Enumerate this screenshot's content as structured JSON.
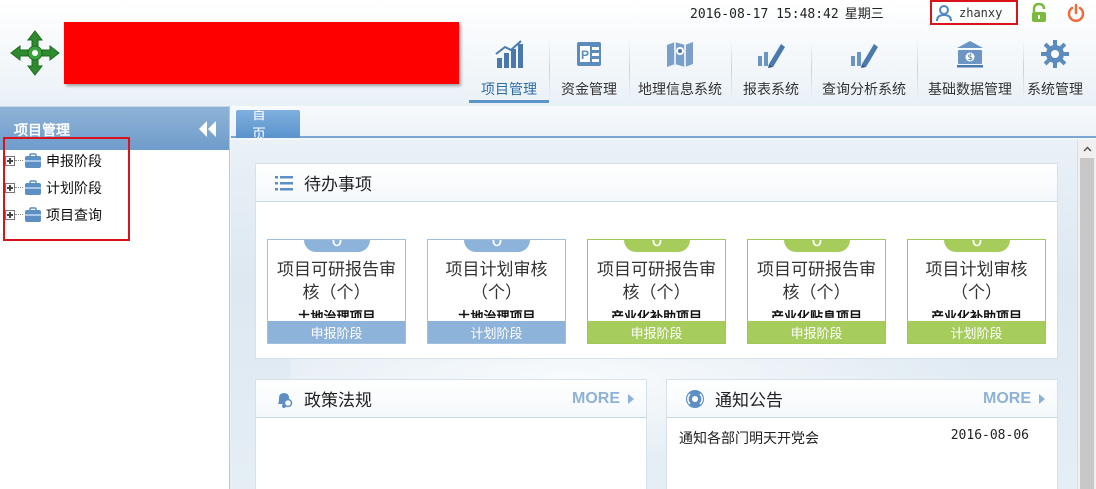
{
  "header": {
    "datetime": "2016-08-17 15:48:42",
    "weekday": "星期三",
    "username": "zhanxy",
    "nav": [
      {
        "label": "项目管理",
        "icon": "bar-chart-icon",
        "active": true
      },
      {
        "label": "资金管理",
        "icon": "ppt-icon",
        "active": false
      },
      {
        "label": "地理信息系统",
        "icon": "map-icon",
        "active": false
      },
      {
        "label": "报表系统",
        "icon": "report-pen-icon",
        "active": false
      },
      {
        "label": "查询分析系统",
        "icon": "query-pen-icon",
        "active": false
      },
      {
        "label": "基础数据管理",
        "icon": "money-icon",
        "active": false
      },
      {
        "label": "系统管理",
        "icon": "gear-icon",
        "active": false
      }
    ]
  },
  "sidebar": {
    "title": "项目管理",
    "items": [
      {
        "label": "申报阶段"
      },
      {
        "label": "计划阶段"
      },
      {
        "label": "项目查询"
      }
    ]
  },
  "tabs": {
    "home": "首页"
  },
  "todo": {
    "title": "待办事项",
    "cards": [
      {
        "count": "0",
        "title": "项目可研报告审核（个）",
        "subtitle": "土地治理项目",
        "footer": "申报阶段",
        "color": "#8db3da"
      },
      {
        "count": "0",
        "title": "项目计划审核（个）",
        "subtitle": "土地治理项目",
        "footer": "计划阶段",
        "color": "#8db3da"
      },
      {
        "count": "0",
        "title": "项目可研报告审核（个）",
        "subtitle": "产业化补助项目",
        "footer": "申报阶段",
        "color": "#a6cd5c"
      },
      {
        "count": "0",
        "title": "项目可研报告审核（个）",
        "subtitle": "产业化贴息项目",
        "footer": "申报阶段",
        "color": "#a6cd5c"
      },
      {
        "count": "0",
        "title": "项目计划审核（个）",
        "subtitle": "产业化补助项目",
        "footer": "计划阶段",
        "color": "#a6cd5c"
      }
    ]
  },
  "policy": {
    "title": "政策法规",
    "more": "MORE"
  },
  "notice": {
    "title": "通知公告",
    "more": "MORE",
    "items": [
      {
        "title": "通知各部门明天开党会",
        "date": "2016-08-06"
      }
    ]
  },
  "colors": {
    "accent_blue": "#6f9ccc",
    "card_blue": "#8db3da",
    "card_green": "#a6cd5c",
    "highlight_red": "#d8141a"
  }
}
